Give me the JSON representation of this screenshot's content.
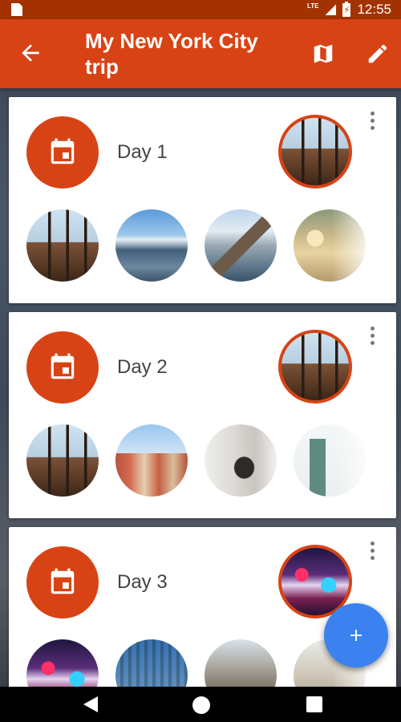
{
  "status_bar": {
    "network": "LTE",
    "battery_symbol": "⚡",
    "time": "12:55"
  },
  "app_bar": {
    "title": "My New York City trip",
    "icons": [
      "back-arrow-icon",
      "map-icon",
      "edit-icon"
    ]
  },
  "cards": [
    {
      "label": "Day 1",
      "icon": "calendar-icon",
      "cover": "restaurant-view-photo",
      "photos": [
        "restaurant-view-photo",
        "lake-photo",
        "bridge-photo",
        "station-photo"
      ]
    },
    {
      "label": "Day 2",
      "icon": "calendar-icon",
      "cover": "restaurant-view-photo",
      "photos": [
        "restaurant-view-photo",
        "ellis-island-photo",
        "museum-photo",
        "statue-of-liberty-photo"
      ]
    },
    {
      "label": "Day 3",
      "icon": "calendar-icon",
      "cover": "times-square-photo",
      "photos": [
        "times-square-photo",
        "columns-building-photo",
        "city-street-photo",
        "city-street-photo"
      ]
    }
  ],
  "fab": {
    "icon": "plus-icon"
  },
  "nav_bar": {
    "icons": [
      "back-triangle-icon",
      "home-circle-icon",
      "recents-square-icon"
    ]
  },
  "colors": {
    "primary": "#d84315",
    "status_bar": "#a33200",
    "fab": "#3b82f0"
  }
}
